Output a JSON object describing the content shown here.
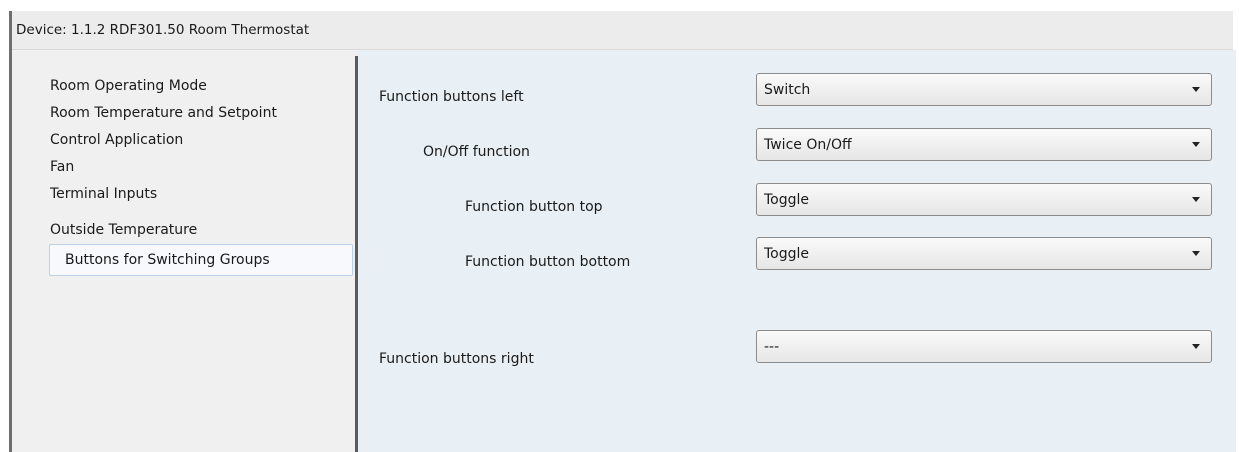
{
  "window": {
    "title": "Device: 1.1.2  RDF301.50 Room Thermostat"
  },
  "sidebar": {
    "items": [
      {
        "label": "Room Operating Mode",
        "selected": false
      },
      {
        "label": "Room Temperature and Setpoint",
        "selected": false
      },
      {
        "label": "Control Application",
        "selected": false
      },
      {
        "label": "Fan",
        "selected": false
      },
      {
        "label": "Terminal Inputs",
        "selected": false
      },
      {
        "label": "Outside Temperature",
        "selected": false
      },
      {
        "label": "Buttons for Switching Groups",
        "selected": true
      }
    ]
  },
  "params": [
    {
      "label": "Function buttons left",
      "value": "Switch"
    },
    {
      "label": "On/Off function",
      "value": "Twice On/Off"
    },
    {
      "label": "Function button top",
      "value": "Toggle"
    },
    {
      "label": "Function button bottom",
      "value": "Toggle"
    },
    {
      "label": "Function buttons right",
      "value": "---"
    }
  ]
}
